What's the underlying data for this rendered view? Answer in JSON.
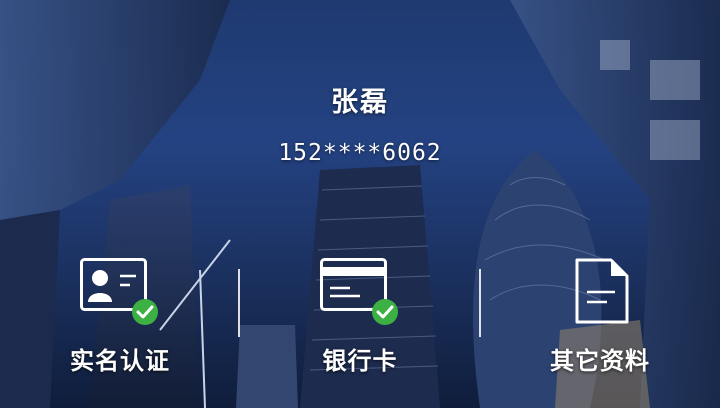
{
  "profile": {
    "name": "张磊",
    "phone": "152****6062"
  },
  "actions": [
    {
      "label": "实名认证",
      "icon": "id-card-verified-icon",
      "verified": true
    },
    {
      "label": "银行卡",
      "icon": "bank-card-verified-icon",
      "verified": true
    },
    {
      "label": "其它资料",
      "icon": "document-icon",
      "verified": false
    }
  ],
  "colors": {
    "check_badge": "#3cb043",
    "text": "#ffffff"
  }
}
